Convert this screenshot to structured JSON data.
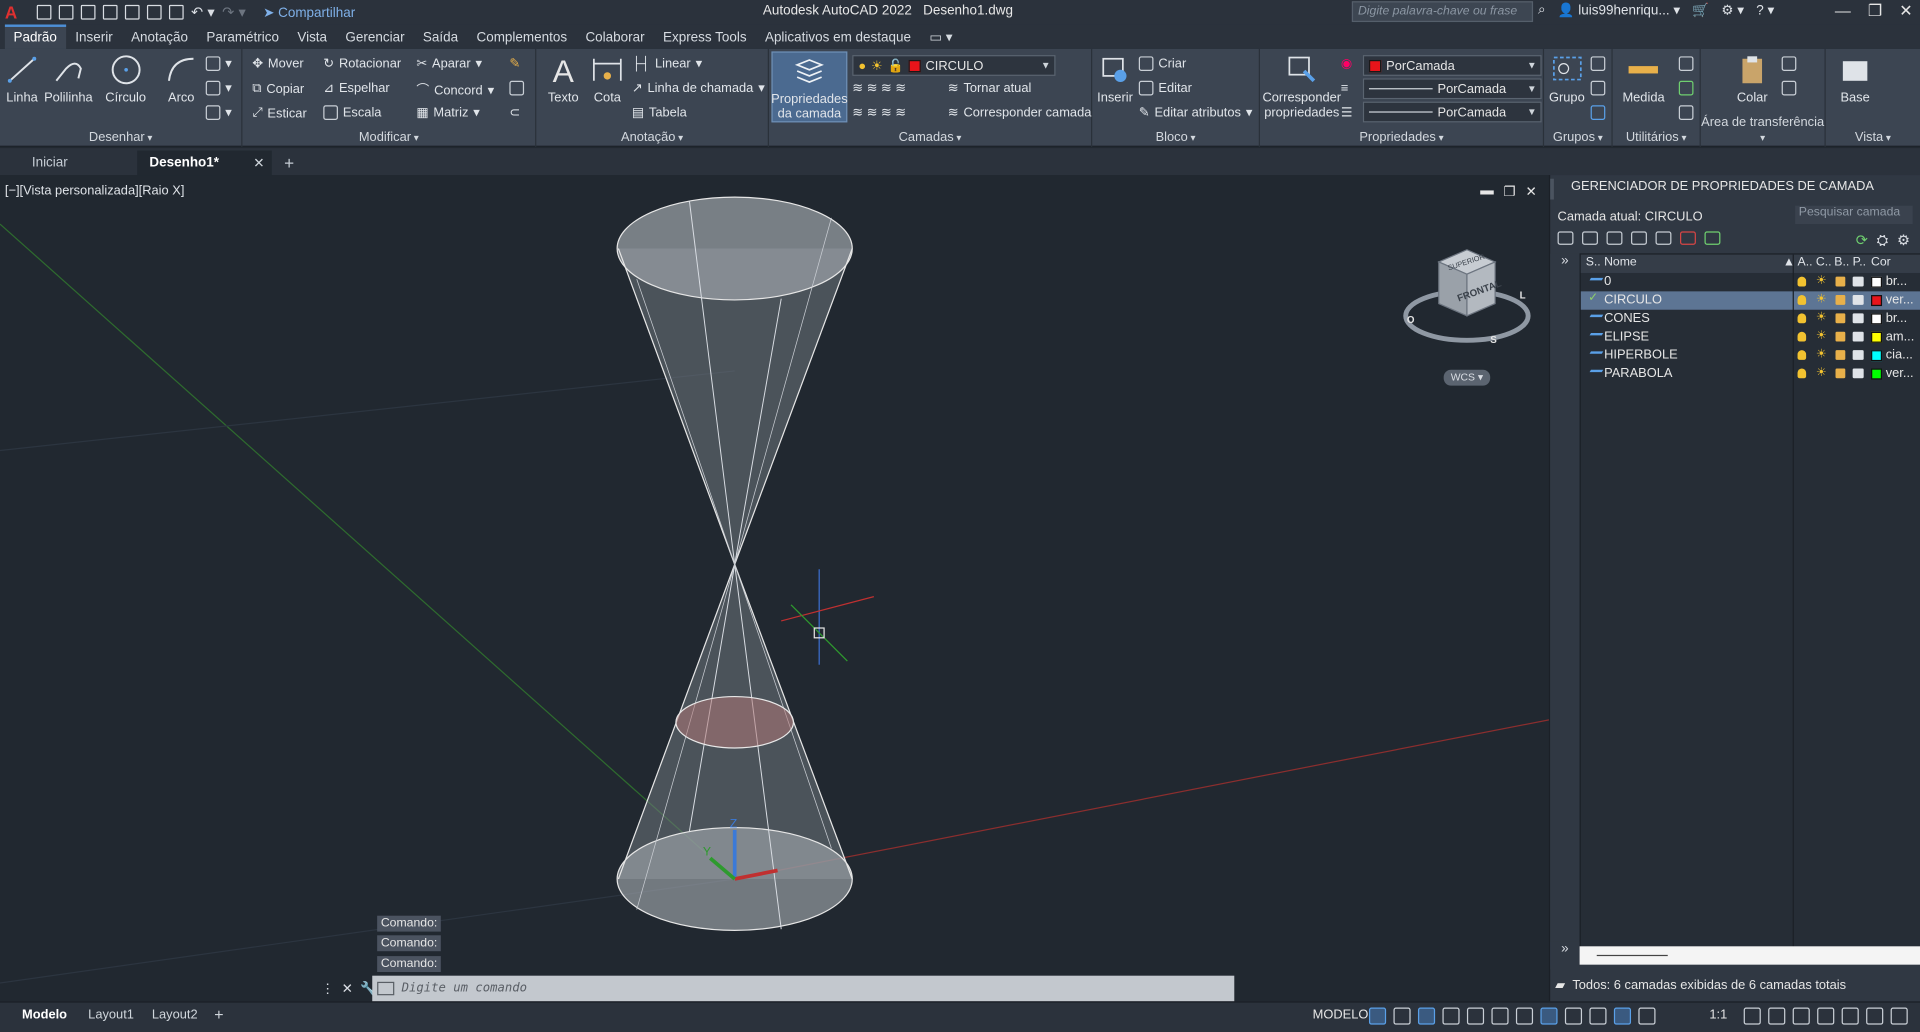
{
  "app": {
    "title": "Autodesk AutoCAD 2022",
    "filename": "Desenho1.dwg",
    "share_label": "Compartilhar",
    "search_placeholder": "Digite palavra-chave ou frase",
    "user": "luis99henriqu...",
    "logo": "A"
  },
  "ribbon_tabs": [
    "Padrão",
    "Inserir",
    "Anotação",
    "Paramétrico",
    "Vista",
    "Gerenciar",
    "Saída",
    "Complementos",
    "Colaborar",
    "Express Tools",
    "Aplicativos em destaque"
  ],
  "ribbon": {
    "draw": {
      "title": "Desenhar",
      "line": "Linha",
      "polyline": "Polilinha",
      "circle": "Círculo",
      "arc": "Arco"
    },
    "modify": {
      "title": "Modificar",
      "move": "Mover",
      "rotate": "Rotacionar",
      "trim": "Aparar",
      "copy": "Copiar",
      "mirror": "Espelhar",
      "fillet": "Concord",
      "stretch": "Esticar",
      "scale": "Escala",
      "array": "Matriz"
    },
    "annotation": {
      "title": "Anotação",
      "text": "Texto",
      "dim": "Cota",
      "linear": "Linear",
      "leader": "Linha de chamada",
      "table": "Tabela"
    },
    "layers": {
      "title": "Camadas",
      "props_btn_1": "Propriedades",
      "props_btn_2": "da camada",
      "current_layer": "CIRCULO",
      "make_current": "Tornar atual",
      "match_layer": "Corresponder camada",
      "current_color": "#e8141a"
    },
    "block": {
      "title": "Bloco",
      "insert": "Inserir",
      "create": "Criar",
      "edit": "Editar",
      "edit_attrs": "Editar atributos"
    },
    "properties": {
      "title": "Propriedades",
      "match_1": "Corresponder",
      "match_2": "propriedades",
      "color": "PorCamada",
      "linetype": "PorCamada",
      "lineweight": "PorCamada",
      "color_swatch": "#e8141a"
    },
    "groups": {
      "title": "Grupos",
      "group": "Grupo"
    },
    "utilities": {
      "title": "Utilitários",
      "measure": "Medida"
    },
    "clipboard": {
      "title": "Área de transferência",
      "paste": "Colar"
    },
    "view": {
      "title": "Vista",
      "base": "Base"
    }
  },
  "doc_tabs": {
    "start": "Iniciar",
    "current": "Desenho1*"
  },
  "viewport": {
    "label": "[−][Vista personalizada][Raio X]",
    "viewcube_top": "SUPERIOR",
    "viewcube_front": "FRONTAL",
    "wcs": "WCS",
    "compass_s": "S",
    "compass_o": "O",
    "compass_l": "L",
    "axis_z": "Z",
    "axis_y": "Y"
  },
  "command": {
    "history": [
      "Comando:",
      "Comando:",
      "Comando:"
    ],
    "placeholder": "Digite um comando"
  },
  "layer_panel": {
    "title": "GERENCIADOR DE PROPRIEDADES DE CAMADA",
    "current": "Camada atual: CIRCULO",
    "search": "Pesquisar camada",
    "headers": {
      "status": "S..",
      "name": "Nome",
      "on": "A..",
      "freeze": "C..",
      "lock": "B..",
      "plot": "P..",
      "color": "Cor"
    },
    "layers": [
      {
        "name": "0",
        "color": "#ffffff",
        "color_name": "br..."
      },
      {
        "name": "CIRCULO",
        "color": "#e8141a",
        "color_name": "ver...",
        "current": true
      },
      {
        "name": "CONES",
        "color": "#ffffff",
        "color_name": "br..."
      },
      {
        "name": "ELIPSE",
        "color": "#ffff00",
        "color_name": "am..."
      },
      {
        "name": "HIPERBOLE",
        "color": "#00ffff",
        "color_name": "cia..."
      },
      {
        "name": "PARABOLA",
        "color": "#00ff00",
        "color_name": "ver..."
      }
    ],
    "status": "Todos: 6 camadas exibidas de 6 camadas totais"
  },
  "statusbar": {
    "model_tab": "Modelo",
    "layout1": "Layout1",
    "layout2": "Layout2",
    "model_label": "MODELO",
    "scale": "1:1"
  }
}
